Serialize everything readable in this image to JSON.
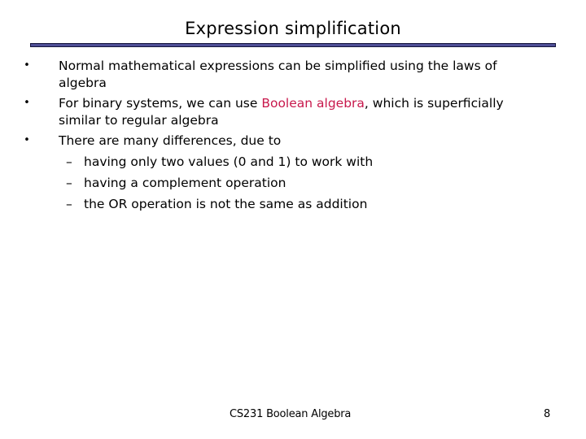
{
  "slide": {
    "title": "Expression simplification",
    "bullets": [
      {
        "marker": "•",
        "line1": "Normal mathematical expressions can be simplified using the laws of",
        "line2": "algebra"
      },
      {
        "marker": "•",
        "line1_before": "For binary systems, we can use ",
        "line1_highlight": "Boolean algebra",
        "line1_after": ", which is superficially",
        "line2": "similar to regular algebra"
      },
      {
        "marker": "•",
        "line1": "There are many differences, due to",
        "sub_items": [
          {
            "marker": "–",
            "text": "having only two values (0 and 1) to work with"
          },
          {
            "marker": "–",
            "text": "having a complement operation"
          },
          {
            "marker": "–",
            "text": "the OR operation is not the same as addition"
          }
        ]
      }
    ],
    "highlight_color": "#c8184c",
    "rule_color": "#4f4f96"
  },
  "footer": {
    "course_label": "CS231 Boolean Algebra",
    "page_number": "8"
  }
}
